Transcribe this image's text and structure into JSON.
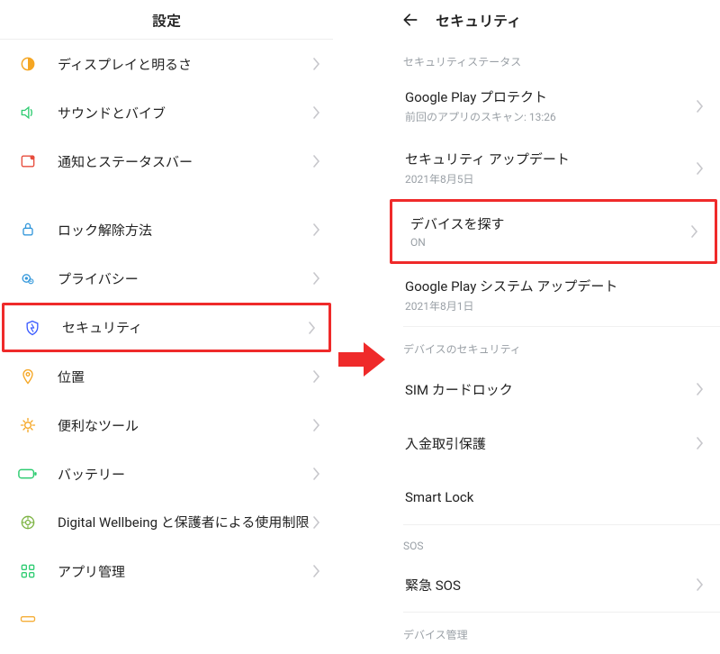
{
  "left": {
    "title": "設定",
    "items": [
      {
        "name": "display",
        "label": "ディスプレイと明るさ"
      },
      {
        "name": "sound",
        "label": "サウンドとバイブ"
      },
      {
        "name": "notif",
        "label": "通知とステータスバー"
      },
      {
        "name": "lock",
        "label": "ロック解除方法"
      },
      {
        "name": "privacy",
        "label": "プライバシー"
      },
      {
        "name": "security",
        "label": "セキュリティ"
      },
      {
        "name": "location",
        "label": "位置"
      },
      {
        "name": "tools",
        "label": "便利なツール"
      },
      {
        "name": "battery",
        "label": "バッテリー"
      },
      {
        "name": "wellbeing",
        "label": "Digital Wellbeing と保護者による使用制限"
      },
      {
        "name": "apps",
        "label": "アプリ管理"
      }
    ]
  },
  "right": {
    "title": "セキュリティ",
    "sections": {
      "status": "セキュリティステータス",
      "device_sec": "デバイスのセキュリティ",
      "sos": "SOS",
      "device_admin": "デバイス管理"
    },
    "items": {
      "play_protect": {
        "label": "Google Play プロテクト",
        "sub": "前回のアプリのスキャン: 13:26"
      },
      "sec_update": {
        "label": "セキュリティ アップデート",
        "sub": "2021年8月5日"
      },
      "find_device": {
        "label": "デバイスを探す",
        "sub": "ON"
      },
      "play_sys": {
        "label": "Google Play システム アップデート",
        "sub": "2021年8月1日"
      },
      "sim_lock": {
        "label": "SIM カードロック"
      },
      "deposit": {
        "label": "入金取引保護"
      },
      "smart_lock": {
        "label": "Smart Lock"
      },
      "sos": {
        "label": "緊急 SOS"
      }
    }
  }
}
